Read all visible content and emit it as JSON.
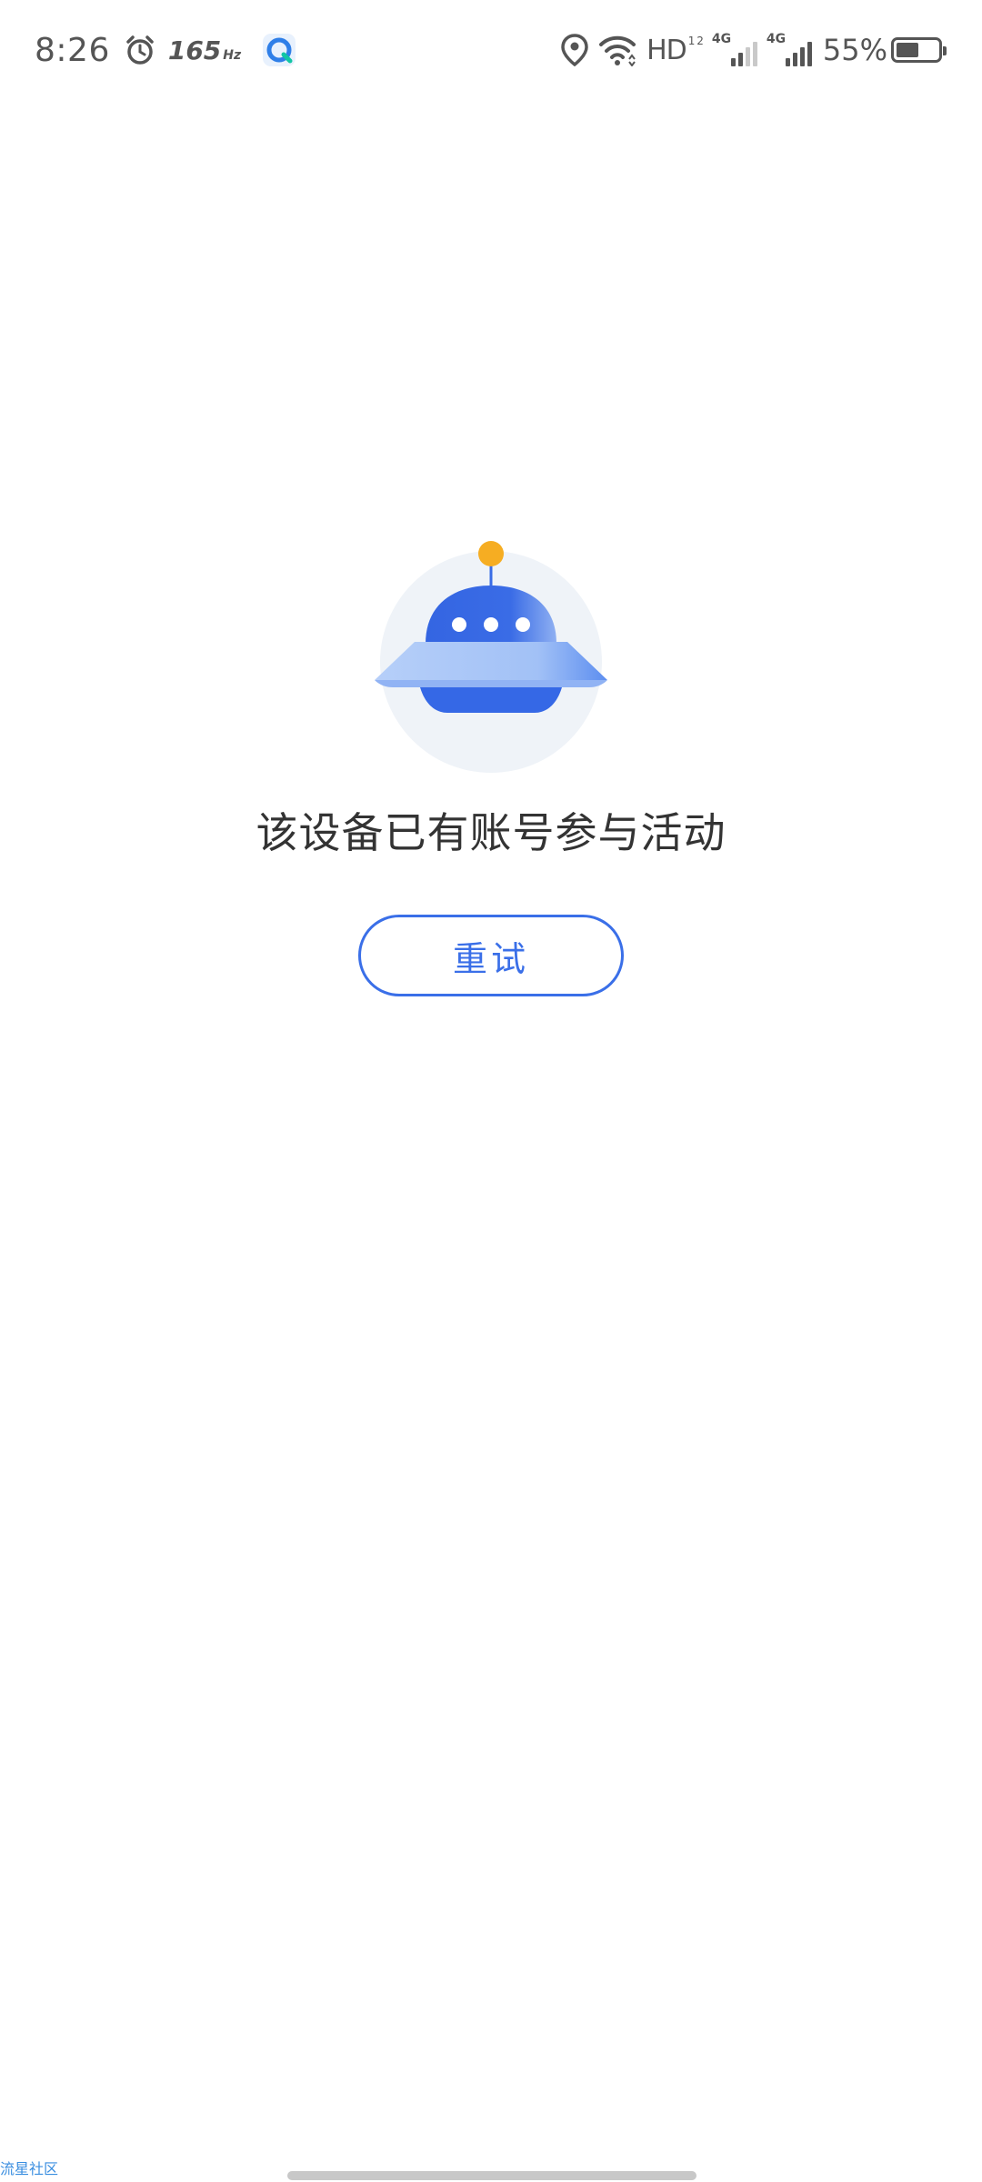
{
  "status_bar": {
    "time": "8:26",
    "refresh_rate": "165",
    "refresh_rate_unit": "Hz",
    "hd_label": "HD",
    "hd_sub": "1 2",
    "sim1_network": "4G",
    "sim2_network": "4G",
    "battery_text": "55%",
    "battery_level": 0.55,
    "icons": [
      "alarm-icon",
      "app-notification-icon",
      "location-icon",
      "wifi-icon",
      "signal-icon",
      "battery-icon"
    ]
  },
  "main": {
    "illustration": "ufo-empty-state-icon",
    "message": "该设备已有账号参与活动",
    "retry_label": "重试"
  },
  "footer": {
    "watermark": "流星社区"
  },
  "colors": {
    "accent": "#3a6fe8",
    "ufo_dome": "#3666e3",
    "ufo_disc": "#a9c6f7",
    "antenna_ball": "#f6ad22",
    "circle_bg": "#eff3f8"
  }
}
